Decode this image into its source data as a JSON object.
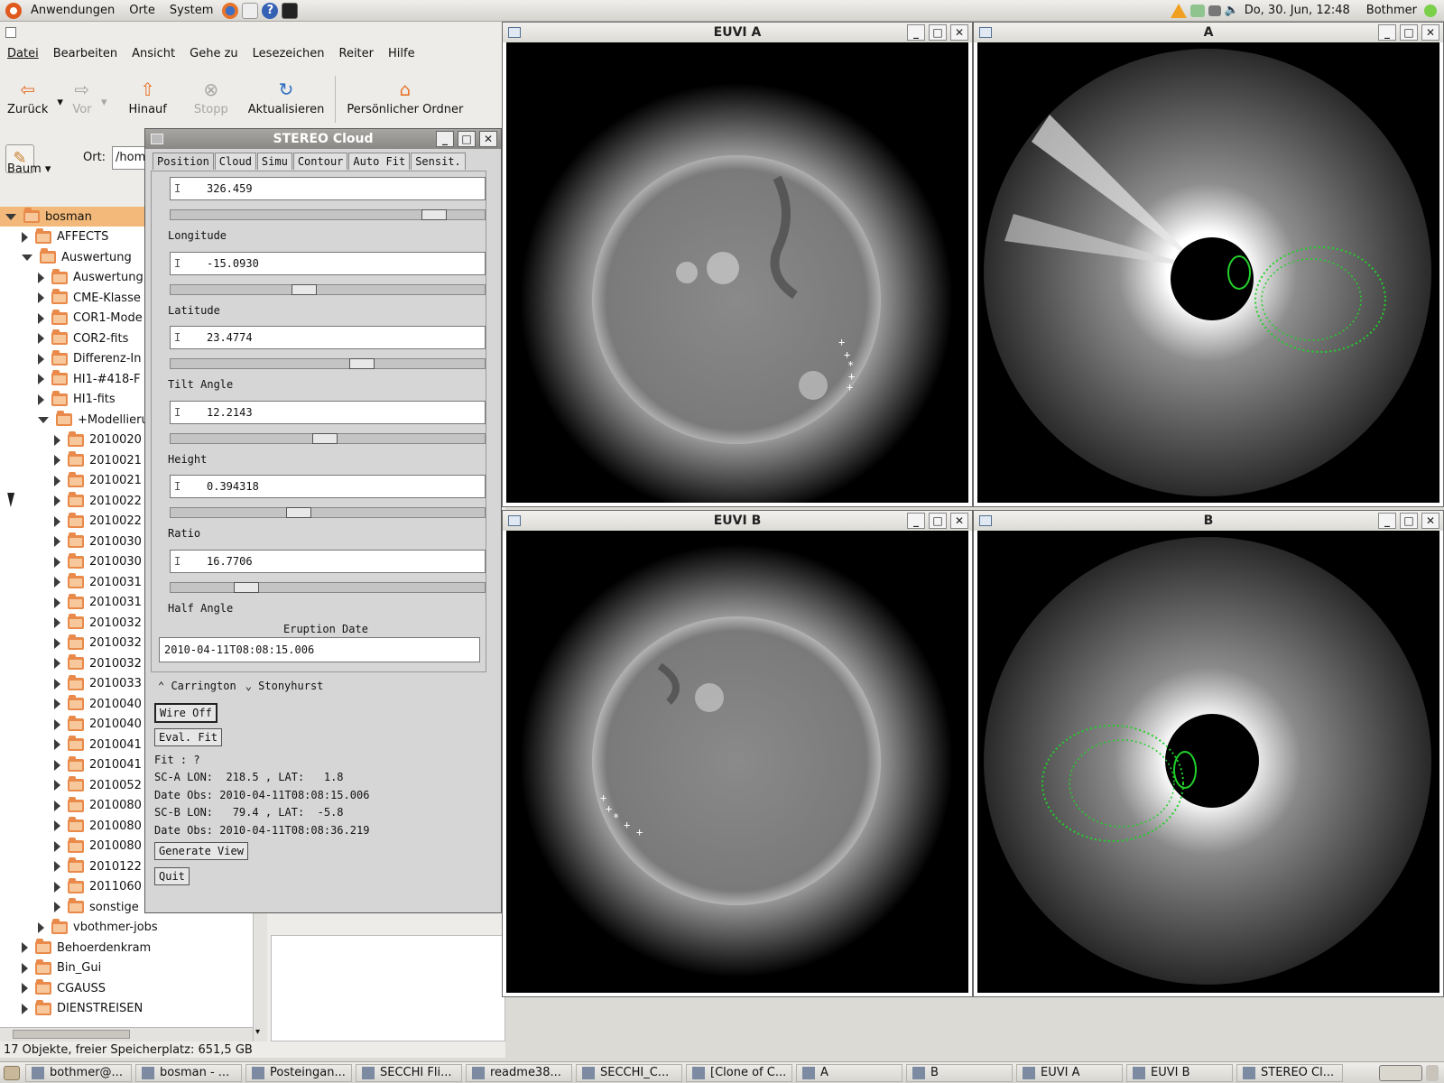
{
  "top_panel": {
    "menus": [
      "Anwendungen",
      "Orte",
      "System"
    ],
    "datetime": "Do, 30. Jun, 12:48",
    "user": "Bothmer"
  },
  "nautilus": {
    "menubar": [
      "Datei",
      "Bearbeiten",
      "Ansicht",
      "Gehe zu",
      "Lesezeichen",
      "Reiter",
      "Hilfe"
    ],
    "toolbar": {
      "back": "Zurück",
      "forward": "Vor",
      "up": "Hinauf",
      "stop": "Stopp",
      "reload": "Aktualisieren",
      "home": "Persönlicher Ordner"
    },
    "location_label": "Ort:",
    "location_value": "/hom",
    "sidebar_mode": "Baum",
    "tree": [
      {
        "label": "bosman",
        "depth": 1,
        "open": true,
        "selected": true
      },
      {
        "label": "AFFECTS",
        "depth": 2,
        "open": false
      },
      {
        "label": "Auswertung",
        "depth": 2,
        "open": true
      },
      {
        "label": "Auswertung",
        "depth": 3,
        "open": false
      },
      {
        "label": "CME-Klasse",
        "depth": 3,
        "open": false
      },
      {
        "label": "COR1-Mode",
        "depth": 3,
        "open": false
      },
      {
        "label": "COR2-fits",
        "depth": 3,
        "open": false
      },
      {
        "label": "Differenz-In",
        "depth": 3,
        "open": false
      },
      {
        "label": "HI1-#418-F",
        "depth": 3,
        "open": false
      },
      {
        "label": "HI1-fits",
        "depth": 3,
        "open": false
      },
      {
        "label": "+Modellierun",
        "depth": 3,
        "open": true
      },
      {
        "label": "2010020",
        "depth": 4,
        "open": false
      },
      {
        "label": "2010021",
        "depth": 4,
        "open": false
      },
      {
        "label": "2010021",
        "depth": 4,
        "open": false
      },
      {
        "label": "2010022",
        "depth": 4,
        "open": false
      },
      {
        "label": "2010022",
        "depth": 4,
        "open": false
      },
      {
        "label": "2010030",
        "depth": 4,
        "open": false
      },
      {
        "label": "2010030",
        "depth": 4,
        "open": false
      },
      {
        "label": "2010031",
        "depth": 4,
        "open": false
      },
      {
        "label": "2010031",
        "depth": 4,
        "open": false
      },
      {
        "label": "2010032",
        "depth": 4,
        "open": false
      },
      {
        "label": "2010032",
        "depth": 4,
        "open": false
      },
      {
        "label": "2010032",
        "depth": 4,
        "open": false
      },
      {
        "label": "2010033",
        "depth": 4,
        "open": false
      },
      {
        "label": "2010040",
        "depth": 4,
        "open": false
      },
      {
        "label": "2010040",
        "depth": 4,
        "open": false
      },
      {
        "label": "2010041",
        "depth": 4,
        "open": false
      },
      {
        "label": "2010041",
        "depth": 4,
        "open": false
      },
      {
        "label": "2010052",
        "depth": 4,
        "open": false
      },
      {
        "label": "2010080",
        "depth": 4,
        "open": false
      },
      {
        "label": "2010080",
        "depth": 4,
        "open": false
      },
      {
        "label": "2010080",
        "depth": 4,
        "open": false
      },
      {
        "label": "2010122",
        "depth": 4,
        "open": false
      },
      {
        "label": "2011060",
        "depth": 4,
        "open": false
      },
      {
        "label": "sonstige",
        "depth": 4,
        "open": false
      },
      {
        "label": "vbothmer-jobs",
        "depth": 3,
        "open": false
      },
      {
        "label": "Behoerdenkram",
        "depth": 2,
        "open": false
      },
      {
        "label": "Bin_Gui",
        "depth": 2,
        "open": false
      },
      {
        "label": "CGAUSS",
        "depth": 2,
        "open": false
      },
      {
        "label": "DIENSTREISEN",
        "depth": 2,
        "open": false
      }
    ],
    "status": "17 Objekte, freier Speicherplatz: 651,5 GB"
  },
  "cloud": {
    "title": "STEREO Cloud",
    "tabs": [
      "Position",
      "Cloud",
      "Simu",
      "Contour",
      "Auto Fit",
      "Sensit."
    ],
    "active_tab": "Position",
    "params": [
      {
        "label": "Longitude",
        "value": "326.459",
        "slider_pos": 0.87
      },
      {
        "label": "Latitude",
        "value": "-15.0930",
        "slider_pos": 0.42
      },
      {
        "label": "Tilt Angle",
        "value": "23.4774",
        "slider_pos": 0.62
      },
      {
        "label": "Height",
        "value": "12.2143",
        "slider_pos": 0.49
      },
      {
        "label": "Ratio",
        "value": "0.394318",
        "slider_pos": 0.4
      },
      {
        "label": "Half Angle",
        "value": "16.7706",
        "slider_pos": 0.22
      }
    ],
    "eruption_label": "Eruption Date",
    "eruption_value": "2010-04-11T08:08:15.006",
    "radio_carrington": "Carrington",
    "radio_stonyhurst": "Stonyhurst",
    "wire_btn": "Wire Off",
    "eval_btn": "Eval. Fit",
    "fit_text": "Fit : ?",
    "sca_text": "SC-A LON:  218.5 , LAT:   1.8",
    "sca_date": "Date Obs: 2010-04-11T08:08:15.006",
    "scb_text": "SC-B LON:   79.4 , LAT:  -5.8",
    "scb_date": "Date Obs: 2010-04-11T08:08:36.219",
    "generate_btn": "Generate View",
    "quit_btn": "Quit"
  },
  "windows": {
    "euvi_a": "EUVI A",
    "cor_a": "A",
    "euvi_b": "EUVI B",
    "cor_b": "B"
  },
  "taskbar": [
    "bothmer@...",
    "bosman - ...",
    "Posteingan...",
    "SECCHI Fli...",
    "readme38...",
    "SECCHI_C...",
    "[Clone of C...",
    "A",
    "B",
    "EUVI A",
    "EUVI B",
    "STEREO Cl..."
  ],
  "colors": {
    "folder": "#e98a4a",
    "selection": "#f3b97a",
    "wireframe": "#22d02a"
  }
}
